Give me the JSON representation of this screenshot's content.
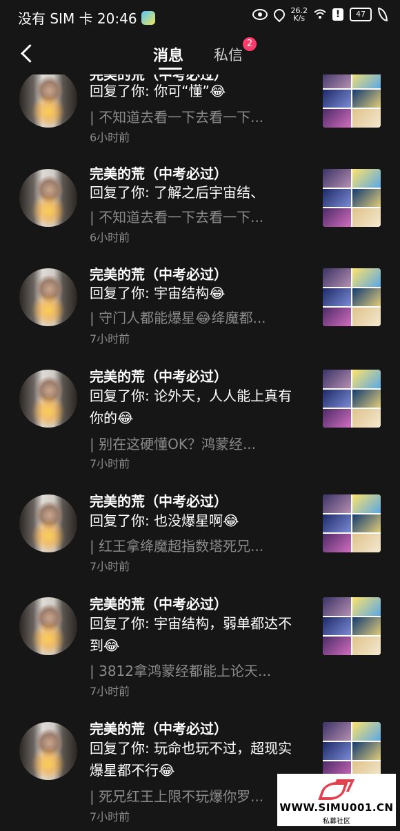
{
  "status_bar": {
    "carrier_time": "没有 SIM 卡 20:46",
    "net_speed_value": "26.2",
    "net_speed_unit": "K/s",
    "battery": "47",
    "icons": [
      "gallery-icon",
      "eye-icon",
      "location-icon",
      "wifi-icon",
      "alert-icon",
      "battery-icon",
      "leaf-icon"
    ]
  },
  "nav": {
    "tab_messages": "消息",
    "tab_private": "私信",
    "private_badge": "2"
  },
  "messages": [
    {
      "name": "完美的荒（中考必过）",
      "reply": "回复了你: 你可“懂”😂",
      "quote": "| 不知道去看一下去看一下...",
      "time": "6小时前"
    },
    {
      "name": "完美的荒（中考必过）",
      "reply": "回复了你: 了解之后宇宙结、",
      "quote": "| 不知道去看一下去看一下...",
      "time": "6小时前"
    },
    {
      "name": "完美的荒（中考必过）",
      "reply": "回复了你: 宇宙结构😂",
      "quote": "| 守门人都能爆星😂绛魔都...",
      "time": "7小时前"
    },
    {
      "name": "完美的荒（中考必过）",
      "reply": "回复了你: 论外天，人人能上真有你的😂",
      "quote": "| 别在这硬懂OK？鸿蒙经...",
      "time": "7小时前"
    },
    {
      "name": "完美的荒（中考必过）",
      "reply": "回复了你: 也没爆星啊😂",
      "quote": "| 红王拿绛魔超指数塔死兄...",
      "time": "7小时前"
    },
    {
      "name": "完美的荒（中考必过）",
      "reply": "回复了你: 宇宙结构，弱单都达不到😂",
      "quote": "| 3812拿鸿蒙经都能上论天...",
      "time": "7小时前"
    },
    {
      "name": "完美的荒（中考必过）",
      "reply": "回复了你: 玩命也玩不过，超现实爆星都不行😂",
      "quote": "| 死兄红王上限不玩爆你罗...",
      "time": "7小时前"
    }
  ],
  "watermark": {
    "url": "WWW.SIMU001.CN",
    "sub": "私募社区"
  }
}
